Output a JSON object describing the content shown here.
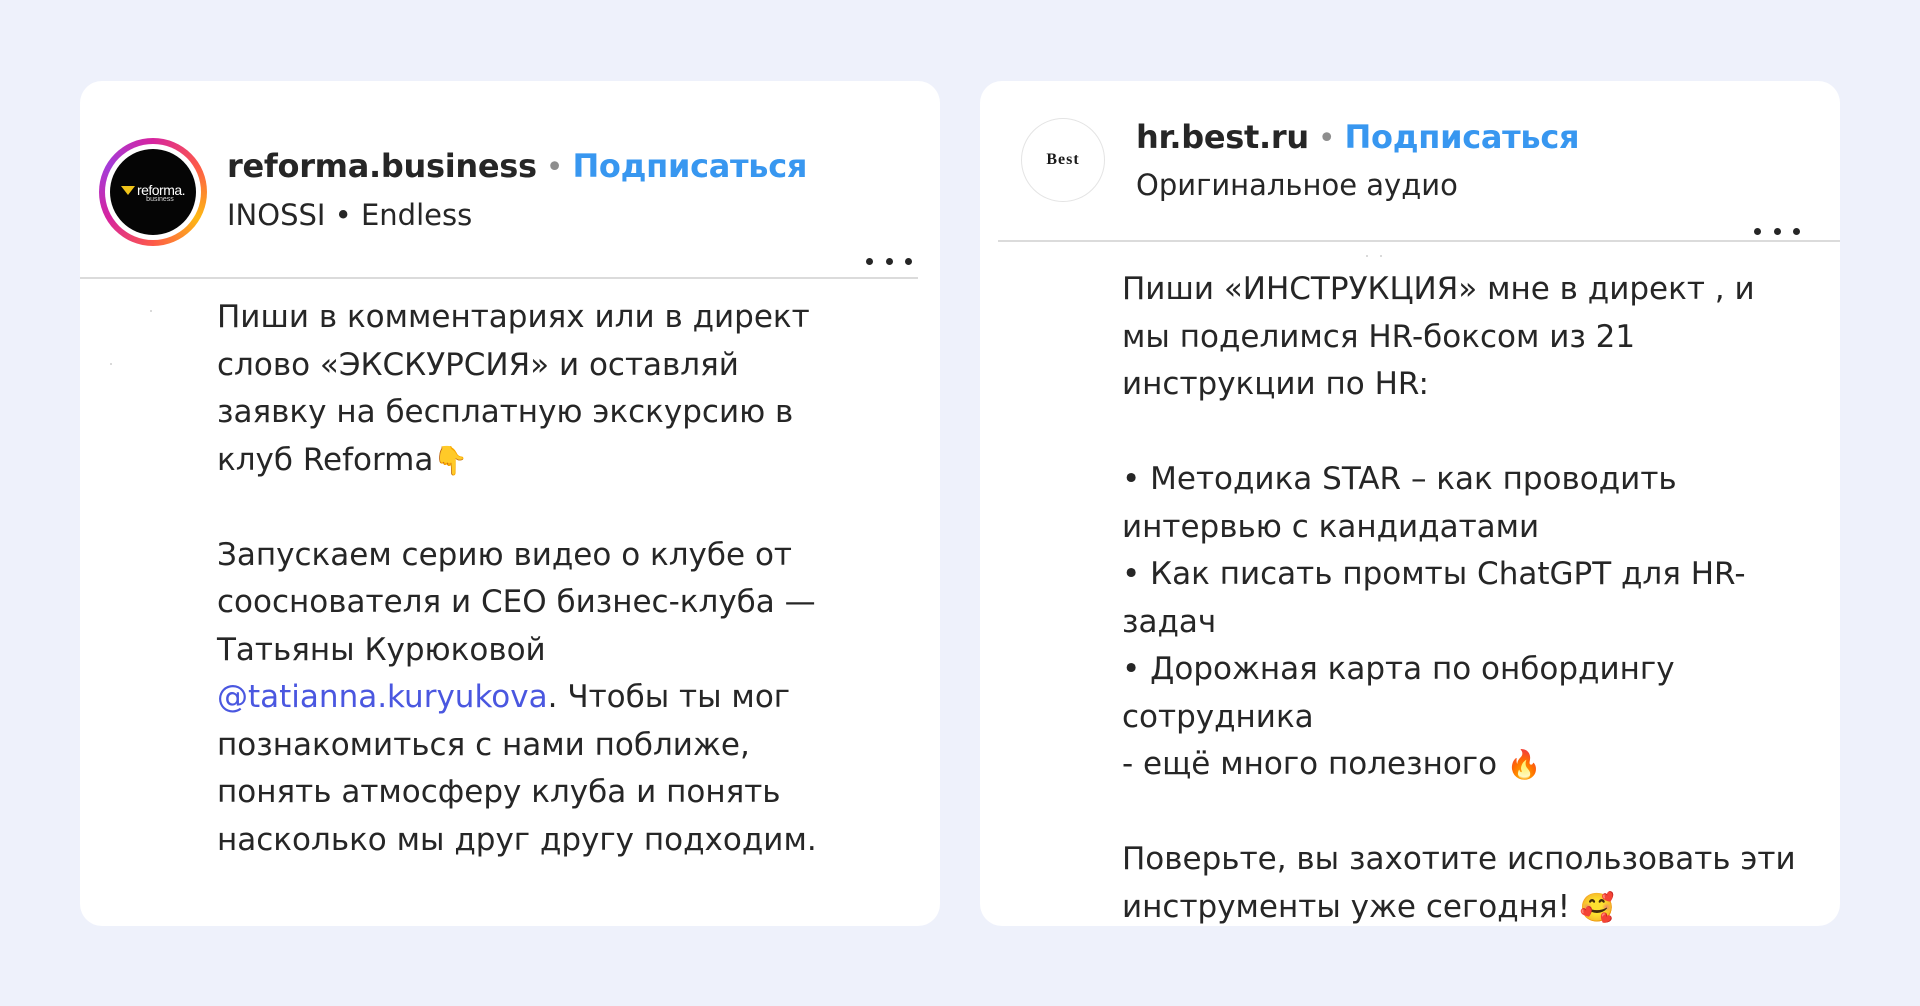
{
  "posts": [
    {
      "username": "reforma.business",
      "follow_label": "Подписаться",
      "separator": "•",
      "subtitle": "INOSSI • Endless",
      "avatar": {
        "logo_text": "reforma.",
        "logo_sub": "business"
      },
      "caption": {
        "part1": "Пиши в комментариях или в директ\nслово «ЭКСКУРСИЯ» и оставляй\nзаявку на бесплатную экскурсию в\nклуб Reforma",
        "emoji1": "👇",
        "part2": "\n\nЗапускаем серию видео о клубе от\nсооснователя и CEO бизнес-клуба —\nТатьяны Курюковой\n",
        "mention": "@tatianna.kuryukova",
        "part3": ". Чтобы ты мог\nпознакомиться с нами поближе,\nпонять атмосферу клуба и понять\nнасколько мы друг другу подходим."
      }
    },
    {
      "username": "hr.best.ru",
      "follow_label": "Подписаться",
      "separator": "•",
      "subtitle": "Оригинальное аудио",
      "avatar": {
        "logo_text": "Best"
      },
      "caption": {
        "part1": "Пиши «ИНСТРУКЦИЯ» мне в директ , и\nмы поделимся HR-боксом из 21\nинструкции по HR:\n\n• Методика STAR – как проводить\nинтервью с кандидатами\n• Как писать промты ChatGPT для HR-\nзадач\n• Дорожная карта по онбордингу\nсотрудника\n- ещё много полезного ",
        "emoji1": "🔥",
        "part2": "\n\nПоверьте, вы захотите использовать эти\nинструменты уже сегодня! ",
        "emoji2": "🥰"
      }
    }
  ],
  "colors": {
    "background": "#eef1fb",
    "follow": "#3897f0",
    "mention": "#4a57e0",
    "text": "#262626"
  },
  "icons": [
    "more-options-icon",
    "avatar-ring"
  ]
}
